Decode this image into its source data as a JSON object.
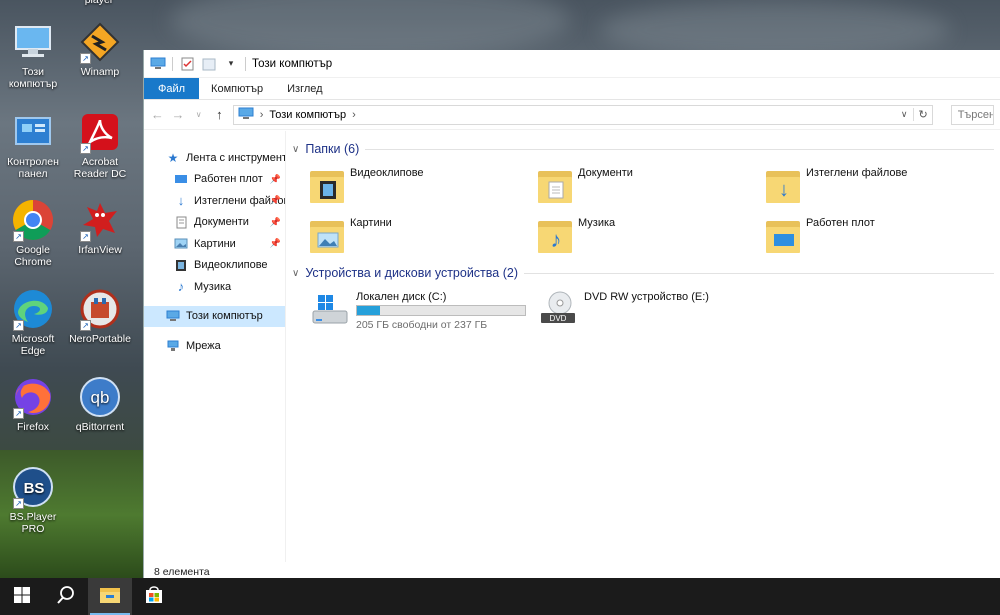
{
  "desktop": {
    "icons": [
      {
        "label": "Този компютър",
        "icon": "computer-icon"
      },
      {
        "label": "Winamp",
        "icon": "winamp-icon"
      },
      {
        "label": "Контролен панел",
        "icon": "control-panel-icon"
      },
      {
        "label": "Acrobat Reader DC",
        "icon": "acrobat-icon"
      },
      {
        "label": "Google Chrome",
        "icon": "chrome-icon"
      },
      {
        "label": "IrfanView",
        "icon": "irfanview-icon"
      },
      {
        "label": "Microsoft Edge",
        "icon": "edge-icon"
      },
      {
        "label": "NeroPortable",
        "icon": "nero-icon"
      },
      {
        "label": "Firefox",
        "icon": "firefox-icon"
      },
      {
        "label": "qBittorrent",
        "icon": "qbittorrent-icon"
      },
      {
        "label": "BS.Player PRO",
        "icon": "bsplayer-icon"
      }
    ],
    "partial_top_label": "player"
  },
  "window": {
    "title": "Този компютър",
    "ribbon_tabs": [
      "Файл",
      "Компютър",
      "Изглед"
    ],
    "address": {
      "path_item": "Този компютър",
      "search_placeholder": "Търсене"
    },
    "nav": {
      "quick_access": "Лента с инструменти",
      "items": [
        {
          "label": "Работен плот",
          "pinned": true,
          "icon": "desktop-icon"
        },
        {
          "label": "Изтеглени файлове",
          "pinned": true,
          "icon": "download-icon"
        },
        {
          "label": "Документи",
          "pinned": true,
          "icon": "documents-icon"
        },
        {
          "label": "Картини",
          "pinned": true,
          "icon": "pictures-icon"
        },
        {
          "label": "Видеоклипове",
          "pinned": false,
          "icon": "videos-icon"
        },
        {
          "label": "Музика",
          "pinned": false,
          "icon": "music-icon"
        }
      ],
      "this_pc": "Този компютър",
      "network": "Мрежа"
    },
    "folders_header": "Папки (6)",
    "folders": [
      {
        "label": "Видеоклипове",
        "icon": "videos-folder-icon"
      },
      {
        "label": "Документи",
        "icon": "documents-folder-icon"
      },
      {
        "label": "Изтеглени файлове",
        "icon": "downloads-folder-icon"
      },
      {
        "label": "Картини",
        "icon": "pictures-folder-icon"
      },
      {
        "label": "Музика",
        "icon": "music-folder-icon"
      },
      {
        "label": "Работен плот",
        "icon": "desktop-folder-icon"
      }
    ],
    "drives_header": "Устройства и дискови устройства (2)",
    "drives": [
      {
        "label": "Локален диск (C:)",
        "free": "205 ГБ свободни от 237 ГБ",
        "used_fraction": 0.135
      },
      {
        "label": "DVD RW устройство (E:)",
        "badge": "DVD"
      }
    ],
    "status": "8 елемента"
  },
  "colors": {
    "accent": "#1979ca",
    "header_text": "#1e3287",
    "selected": "#cce8ff",
    "progress": "#26a0da",
    "taskbar": "#1b1b1b"
  }
}
